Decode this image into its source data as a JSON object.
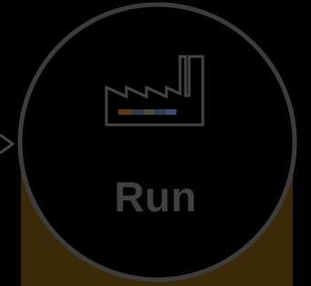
{
  "node": {
    "label": "Run",
    "icon": "factory-icon",
    "incoming_arrow_icon": "chevron-right-icon",
    "colors": {
      "background": "#000000",
      "circle_stroke": "#3c3c3c",
      "circle_fill": "#000000",
      "lower_fill": "#3a2a08",
      "label": "#404040",
      "icon_stroke": "#444444",
      "stripe": [
        "#5a3d0a",
        "#2a3a4a",
        "#4a4a3a",
        "#2a4050",
        "#355070"
      ]
    }
  }
}
